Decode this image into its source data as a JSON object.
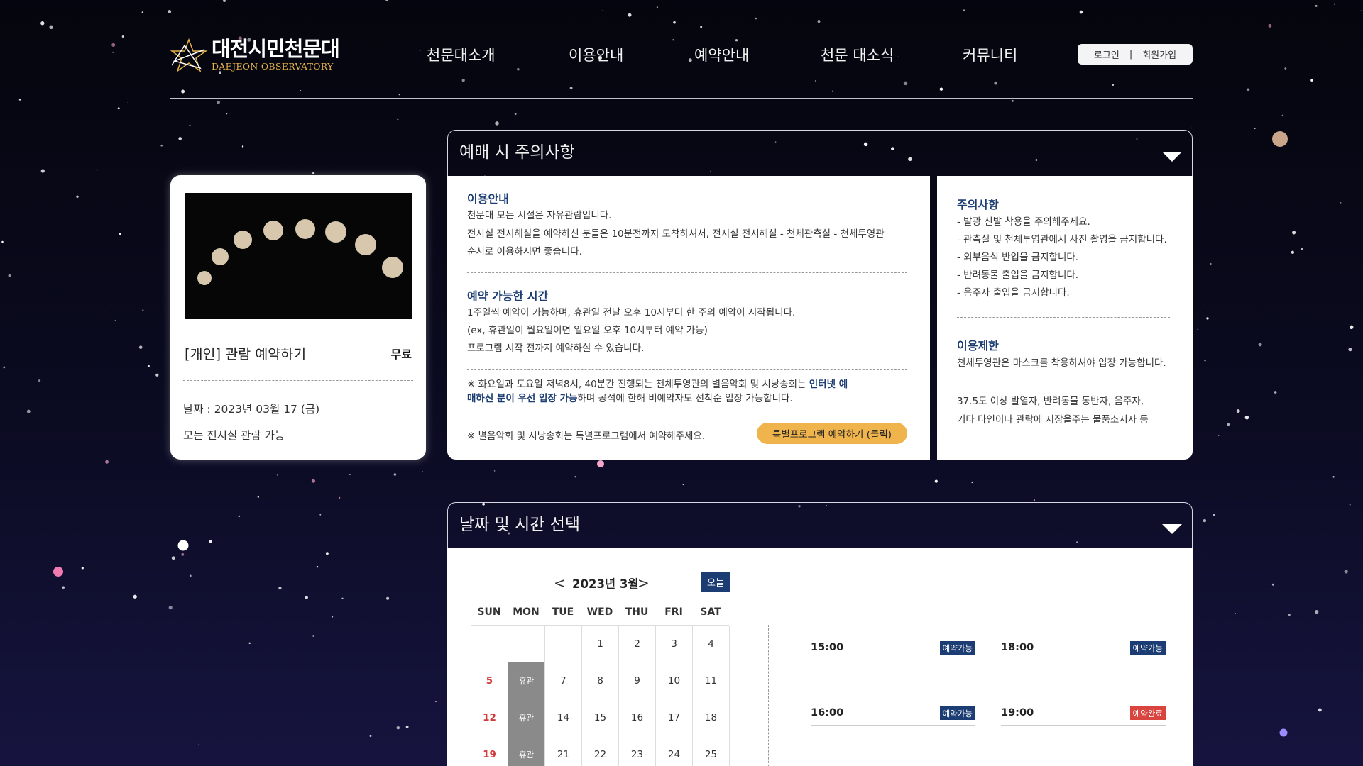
{
  "header": {
    "logo": {
      "title_ko": "대전시민천문대",
      "title_en": "DAEJEON OBSERVATORY"
    },
    "nav": [
      {
        "label": "천문대소개"
      },
      {
        "label": "이용안내"
      },
      {
        "label": "예약안내"
      },
      {
        "label": "천문 대소식"
      },
      {
        "label": "커뮤니티"
      }
    ],
    "auth": {
      "login": "로그인",
      "separator": "|",
      "signup": "회원가입"
    }
  },
  "program_card": {
    "title": "[개인] 관람 예약하기",
    "price": "무료",
    "date": "날짜 : 2023년 03월 17 (금)",
    "note": "모든 전시실 관람 가능"
  },
  "notice_section": {
    "title": "예매 시 주의사항",
    "usage": {
      "heading": "이용안내",
      "lines": [
        "천문대 모든 시설은 자유관람입니다.",
        "전시실 전시해설을 예약하신 분들은 10분전까지 도착하셔서, 전시실 전시해설 - 천체관측실 - 천체투영관",
        "순서로 이용하시면 좋습니다."
      ]
    },
    "reservation_time": {
      "heading": "예약 가능한 시간",
      "lines": [
        "1주일씩 예약이 가능하며, 휴관일 전날 오후 10시부터 한 주의 예약이 시작됩니다.",
        "(ex, 휴관일이 월요일이면 일요일 오후 10시부터 예약 가능)",
        "프로그램 시작 전까지 예약하실 수 있습니다."
      ]
    },
    "star_party": {
      "line1_pre": "※ 화요일과 토요일 저녁8시, 40분간 진행되는 천체투영관의 별음악회 및 시낭송회는 ",
      "line1_em": "인터넷 예",
      "line2_em": "매하신 분이 우선 입장 가능",
      "line2_post": "하며 공석에 한해 비예약자도 선착순 입장 가능합니다.",
      "footer": "※ 별음악회 및 시낭송회는 특별프로그램에서 예약해주세요.",
      "button": "특별프로그램 예약하기 (클릭)"
    },
    "cautions": {
      "heading": "주의사항",
      "items": [
        "- 발광 신발 착용을 주의해주세요.",
        "- 관측실 및 천체투영관에서 사진 촬영을 금지합니다.",
        "- 외부음식 반입을 금지합니다.",
        "- 반려동물 출입을 금지합니다.",
        "- 음주자 출입을 금지합니다."
      ]
    },
    "restrictions": {
      "heading": "이용제한",
      "line1": "천체투영관은 마스크를 착용하셔야 입장 가능합니다.",
      "line2": "37.5도 이상 발열자, 반려동물 동반자, 음주자,",
      "line3": "기타 타인이나 관람에 지장을주는 물품소지자 등"
    }
  },
  "date_section": {
    "title": "날짜 및 시간 선택",
    "month_label": "2023년 3월",
    "prev": "<",
    "next": ">",
    "today": "오늘",
    "weekdays": [
      "SUN",
      "MON",
      "TUE",
      "WED",
      "THU",
      "FRI",
      "SAT"
    ],
    "weeks": [
      [
        "",
        "",
        "",
        "1",
        "2",
        "3",
        "4"
      ],
      [
        "5",
        "휴관",
        "7",
        "8",
        "9",
        "10",
        "11"
      ],
      [
        "12",
        "휴관",
        "14",
        "15",
        "16",
        "17",
        "18"
      ],
      [
        "19",
        "휴관",
        "21",
        "22",
        "23",
        "24",
        "25"
      ]
    ],
    "slots": [
      {
        "time": "15:00",
        "status": "예약가능",
        "color": "#1c3d73"
      },
      {
        "time": "18:00",
        "status": "예약가능",
        "color": "#1c3d73"
      },
      {
        "time": "16:00",
        "status": "예약가능",
        "color": "#1c3d73"
      },
      {
        "time": "19:00",
        "status": "예약완료",
        "color": "#d9443f"
      }
    ]
  },
  "colors": {
    "accent_navy": "#1c3d73",
    "accent_gold": "#f0b44d",
    "logo_gold": "#e6b347",
    "sold_out": "#d9443f"
  }
}
